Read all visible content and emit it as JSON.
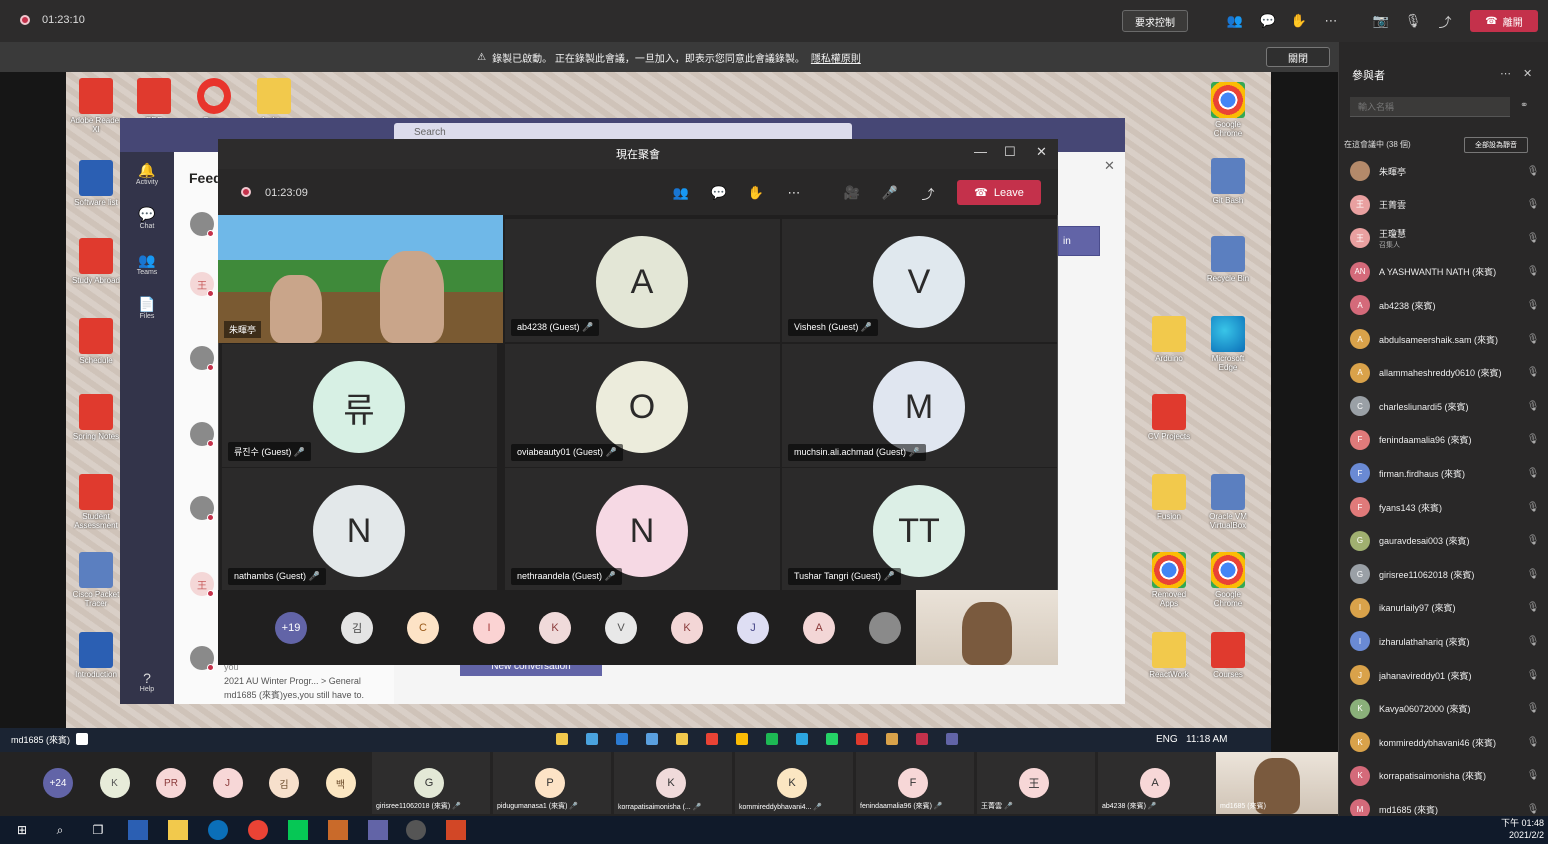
{
  "outer": {
    "timer": "01:23:10",
    "share_label": "要求控制",
    "leave_label": "離開"
  },
  "banner": {
    "text": "錄製已啟動。 正在錄製此會議，一旦加入，即表示您同意此會議錄製。",
    "policy_link": "隱私權原則",
    "close_label": "關閉"
  },
  "desktop_icons": [
    {
      "label": "Adobe Reader XI",
      "kind": "pdf"
    },
    {
      "label": "PDF",
      "kind": "pdf"
    },
    {
      "label": "Opera",
      "kind": "opera"
    },
    {
      "label": "Archive",
      "kind": "folder"
    },
    {
      "label": "Software list",
      "kind": "word"
    },
    {
      "label": "Study Abroad",
      "kind": "pdf"
    },
    {
      "label": "Schedule",
      "kind": "pdf"
    },
    {
      "label": "Spring Notes",
      "kind": "pdf"
    },
    {
      "label": "Student Assessment",
      "kind": "pdf"
    },
    {
      "label": "Cisco Packet Tracer",
      "kind": "box"
    },
    {
      "label": "Introduction",
      "kind": "word"
    },
    {
      "label": "Google Chrome",
      "kind": "chrome"
    },
    {
      "label": "Git Bash",
      "kind": "box"
    },
    {
      "label": "Recycle Bin",
      "kind": "box"
    },
    {
      "label": "Arduino",
      "kind": "folder"
    },
    {
      "label": "Microsoft Edge",
      "kind": "edge"
    },
    {
      "label": "CV Projects",
      "kind": "pdf"
    },
    {
      "label": "Fusion",
      "kind": "folder"
    },
    {
      "label": "Oracle VM VirtualBox",
      "kind": "box"
    },
    {
      "label": "Removed Apps",
      "kind": "chrome"
    },
    {
      "label": "Google Chrome",
      "kind": "chrome"
    },
    {
      "label": "ReactWork",
      "kind": "folder"
    },
    {
      "label": "Courses",
      "kind": "pdf"
    }
  ],
  "teams_bg": {
    "search_placeholder": "Search",
    "feed_title": "Feed",
    "rail": [
      {
        "icon": "bell-icon",
        "glyph": "🔔",
        "label": "Activity"
      },
      {
        "icon": "chat-icon",
        "glyph": "💬",
        "label": "Chat"
      },
      {
        "icon": "teams-icon",
        "glyph": "👥",
        "label": "Teams"
      },
      {
        "icon": "files-icon",
        "glyph": "📄",
        "label": "Files"
      },
      {
        "icon": "help-icon",
        "glyph": "?",
        "label": "Help"
      }
    ],
    "feed_you": "you",
    "feed_line1": "2021 AU Winter Progr... > General",
    "feed_line2": "md1685 (來賓)yes,you still have to.",
    "new_conversation": "New conversation",
    "join_label": "in"
  },
  "meeting": {
    "window_title": "現在聚會",
    "timer": "01:23:09",
    "leave_label": "Leave",
    "video_name": "朱暉亭",
    "tiles": [
      {
        "initial": "A",
        "name": "ab4238 (Guest)",
        "color": "#e3e6d6"
      },
      {
        "initial": "V",
        "name": "Vishesh (Guest)",
        "color": "#e0e8ee"
      },
      {
        "initial": "류",
        "name": "류진수 (Guest)",
        "color": "#d7f0e4"
      },
      {
        "initial": "O",
        "name": "oviabeauty01 (Guest)",
        "color": "#ececdc"
      },
      {
        "initial": "M",
        "name": "muchsin.ali.achmad (Guest)",
        "color": "#e0e6f0"
      },
      {
        "initial": "N",
        "name": "nathambs (Guest)",
        "color": "#e3e8ea"
      },
      {
        "initial": "N",
        "name": "nethraandela (Guest)",
        "color": "#f6d9e4"
      },
      {
        "initial": "TT",
        "name": "Tushar Tangri (Guest)",
        "color": "#dcefe6"
      }
    ],
    "strip": [
      {
        "label": "+19",
        "color": "#6264a7",
        "text": "#ffffff"
      },
      {
        "label": "김",
        "color": "#e4e4e4",
        "text": "#444444"
      },
      {
        "label": "C",
        "color": "#fde3c6",
        "text": "#9a5a1a"
      },
      {
        "label": "I",
        "color": "#fbd3d3",
        "text": "#a33a3a"
      },
      {
        "label": "K",
        "color": "#f0dada",
        "text": "#8a3a3a"
      },
      {
        "label": "V",
        "color": "#e8e8e8",
        "text": "#555555"
      },
      {
        "label": "K",
        "color": "#f3d6d6",
        "text": "#8a3a3a"
      },
      {
        "label": "J",
        "color": "#dedef3",
        "text": "#4a4a8a"
      },
      {
        "label": "A",
        "color": "#f3d6d6",
        "text": "#8a3a3a"
      },
      {
        "label": "",
        "color": "#8a8a8a",
        "text": "#ffffff"
      }
    ]
  },
  "share_taskbar": {
    "user": "md1685 (來賓)",
    "lang": "ENG",
    "clock": "11:18 AM"
  },
  "outer_strip": {
    "avatars": [
      {
        "label": "+24",
        "color": "#6264a7",
        "text": "#ffffff"
      },
      {
        "label": "K",
        "color": "#e7ecd9",
        "text": "#555555"
      },
      {
        "label": "PR",
        "color": "#f7d7d7",
        "text": "#8a3a3a"
      },
      {
        "label": "J",
        "color": "#f7d7d7",
        "text": "#8a3a3a"
      },
      {
        "label": "김",
        "color": "#f7e0cc",
        "text": "#6a4a2a"
      },
      {
        "label": "백",
        "color": "#fbe6c2",
        "text": "#6a4a2a"
      }
    ],
    "tiles": [
      {
        "initial": "G",
        "name": "girisree11062018 (來賓)",
        "color": "#e3e8d6"
      },
      {
        "initial": "P",
        "name": "pidugumanasa1 (來賓)",
        "color": "#fde3c6"
      },
      {
        "initial": "K",
        "name": "korrapatisaimonisha (...",
        "color": "#f0dada"
      },
      {
        "initial": "K",
        "name": "kommireddybhavani4...",
        "color": "#fbe6c2"
      },
      {
        "initial": "F",
        "name": "fenindaamalia96 (來賓)",
        "color": "#f7d7d7"
      },
      {
        "initial": "王",
        "name": "王菁雲",
        "color": "#f7d7d7"
      },
      {
        "initial": "A",
        "name": "ab4238 (來賓)",
        "color": "#f7d7d7"
      }
    ],
    "self_name": "md1685 (來賓)"
  },
  "panel": {
    "title": "參與者",
    "search_placeholder": "輸入名稱",
    "section": "在這會議中 (38 個)",
    "mute_all": "全部設為靜音",
    "participants": [
      {
        "initial": "",
        "name": "朱暉亭",
        "sub": "",
        "color": "#b48a6a"
      },
      {
        "initial": "王",
        "name": "王菁雲",
        "sub": "",
        "color": "#e9a0a0"
      },
      {
        "initial": "王",
        "name": "王瓊慧",
        "sub": "召集人",
        "color": "#e9a0a0"
      },
      {
        "initial": "AN",
        "name": "A YASHWANTH NATH (來賓)",
        "sub": "",
        "color": "#d46a7a"
      },
      {
        "initial": "A",
        "name": "ab4238 (來賓)",
        "sub": "",
        "color": "#d46a7a"
      },
      {
        "initial": "A",
        "name": "abdulsameershaik.sam (來賓)",
        "sub": "",
        "color": "#d9a24a"
      },
      {
        "initial": "A",
        "name": "allammaheshreddy0610 (來賓)",
        "sub": "",
        "color": "#d9a24a"
      },
      {
        "initial": "C",
        "name": "charlesliunardi5 (來賓)",
        "sub": "",
        "color": "#9aa0a6"
      },
      {
        "initial": "F",
        "name": "fenindaamalia96 (來賓)",
        "sub": "",
        "color": "#e07a7a"
      },
      {
        "initial": "F",
        "name": "firman.firdhaus (來賓)",
        "sub": "",
        "color": "#6a8ad4"
      },
      {
        "initial": "F",
        "name": "fyans143 (來賓)",
        "sub": "",
        "color": "#e07a7a"
      },
      {
        "initial": "G",
        "name": "gauravdesai003 (來賓)",
        "sub": "",
        "color": "#a0b070"
      },
      {
        "initial": "G",
        "name": "girisree11062018 (來賓)",
        "sub": "",
        "color": "#9aa0a6"
      },
      {
        "initial": "I",
        "name": "ikanurlaily97 (來賓)",
        "sub": "",
        "color": "#d9a24a"
      },
      {
        "initial": "I",
        "name": "izharulathahariq (來賓)",
        "sub": "",
        "color": "#6a8ad4"
      },
      {
        "initial": "J",
        "name": "jahanavireddy01 (來賓)",
        "sub": "",
        "color": "#d9a24a"
      },
      {
        "initial": "K",
        "name": "Kavya06072000 (來賓)",
        "sub": "",
        "color": "#8ab07a"
      },
      {
        "initial": "K",
        "name": "kommireddybhavani46 (來賓)",
        "sub": "",
        "color": "#d9a24a"
      },
      {
        "initial": "K",
        "name": "korrapatisaimonisha (來賓)",
        "sub": "",
        "color": "#d46a7a"
      },
      {
        "initial": "M",
        "name": "md1685 (來賓)",
        "sub": "",
        "color": "#d46a7a"
      }
    ]
  },
  "win_taskbar": {
    "time": "下午 01:48",
    "date": "2021/2/2"
  }
}
